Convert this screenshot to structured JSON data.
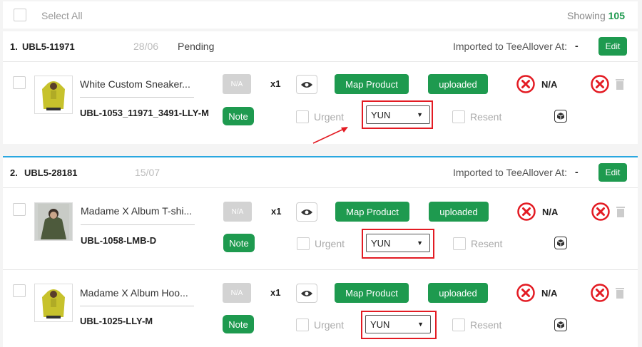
{
  "header": {
    "select_all_label": "Select All",
    "showing_label": "Showing",
    "showing_count": "105"
  },
  "colors": {
    "accent_green": "#1e9a4f",
    "red": "#e31b23",
    "blue_line": "#2aa7e0"
  },
  "orders": [
    {
      "number": "1.",
      "id": "UBL5-11971",
      "date": "28/06",
      "status": "Pending",
      "imported_label": "Imported to TeeAllover At:",
      "imported_value": "-",
      "edit_label": "Edit",
      "items": [
        {
          "title": "White Custom Sneaker...",
          "sku": "UBL-1053_11971_3491-LLY-M",
          "na_button": "N/A",
          "qty": "x1",
          "map_label": "Map Product",
          "uploaded_label": "uploaded",
          "status_na": "N/A",
          "note_label": "Note",
          "urgent_label": "Urgent",
          "shipping": "YUN",
          "resent_label": "Resent"
        }
      ]
    },
    {
      "number": "2.",
      "id": "UBL5-28181",
      "date": "15/07",
      "status": "",
      "imported_label": "Imported to TeeAllover At:",
      "imported_value": "-",
      "edit_label": "Edit",
      "items": [
        {
          "title": "Madame X Album T-shi...",
          "sku": "UBL-1058-LMB-D",
          "na_button": "N/A",
          "qty": "x1",
          "map_label": "Map Product",
          "uploaded_label": "uploaded",
          "status_na": "N/A",
          "note_label": "Note",
          "urgent_label": "Urgent",
          "shipping": "YUN",
          "resent_label": "Resent"
        },
        {
          "title": "Madame X Album Hoo...",
          "sku": "UBL-1025-LLY-M",
          "na_button": "N/A",
          "qty": "x1",
          "map_label": "Map Product",
          "uploaded_label": "uploaded",
          "status_na": "N/A",
          "note_label": "Note",
          "urgent_label": "Urgent",
          "shipping": "YUN",
          "resent_label": "Resent"
        }
      ]
    }
  ]
}
